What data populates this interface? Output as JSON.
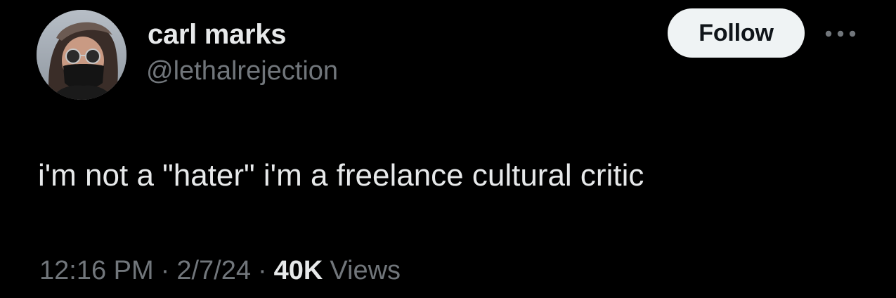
{
  "author": {
    "display_name": "carl marks",
    "handle": "@lethalrejection",
    "avatar_icon": "avatar-photo"
  },
  "actions": {
    "follow_label": "Follow",
    "more_icon": "more-options-icon"
  },
  "tweet": {
    "text": "i'm not a \"hater\" i'm a freelance cultural critic"
  },
  "meta": {
    "time": "12:16 PM",
    "separator": "·",
    "date": "2/7/24",
    "views_count": "40K",
    "views_label": "Views"
  },
  "colors": {
    "background": "#000000",
    "primary_text": "#e7e9ea",
    "secondary_text": "#71767b",
    "follow_button_bg": "#eff3f4",
    "follow_button_text": "#0f1419"
  }
}
